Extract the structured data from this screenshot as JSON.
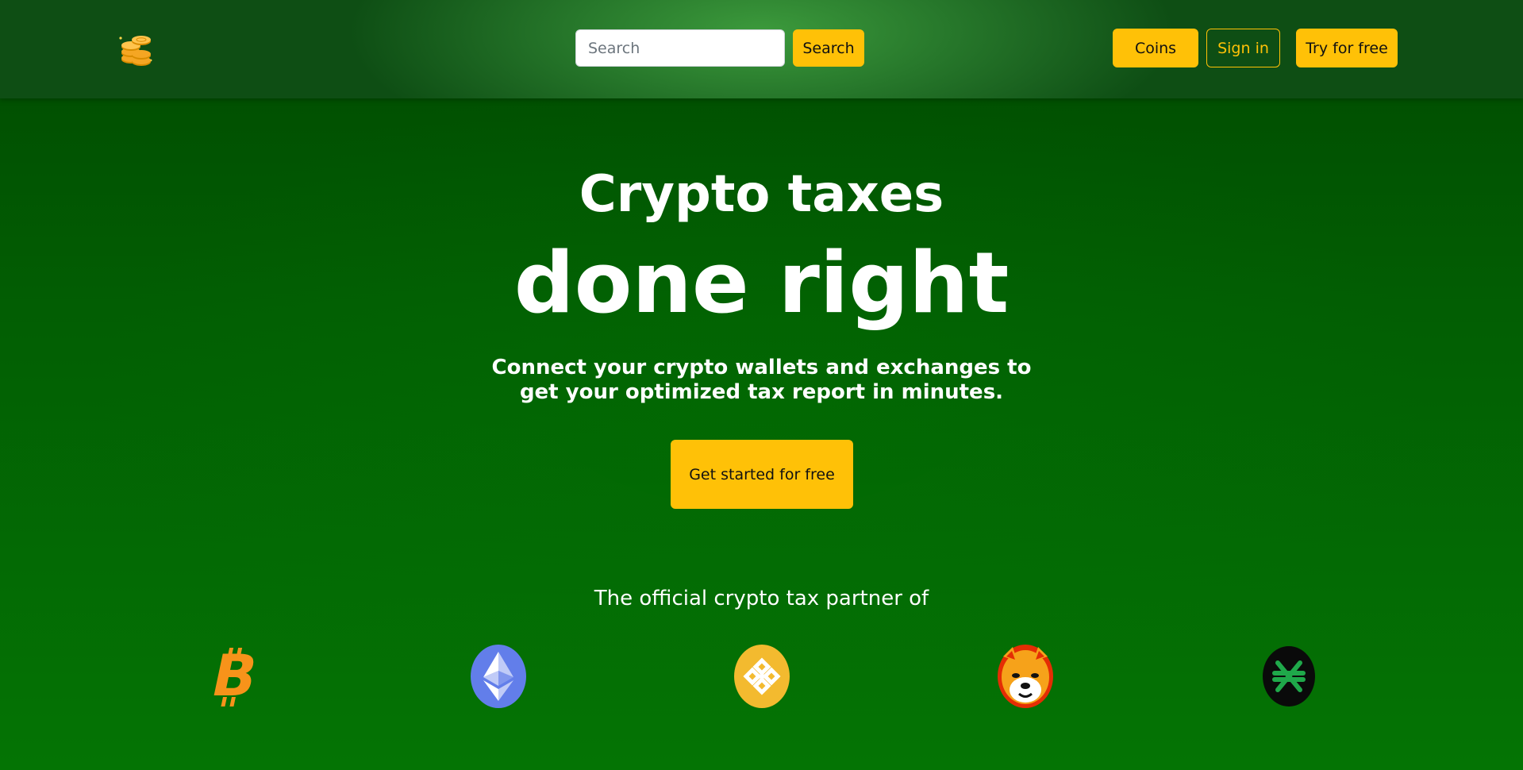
{
  "header": {
    "logo_icon": "coins-stack-icon",
    "search": {
      "placeholder": "Search",
      "value": ""
    },
    "search_button": "Search",
    "nav": {
      "coins": "Coins",
      "sign_in": "Sign in",
      "try_free": "Try for free"
    }
  },
  "hero": {
    "line1": "Crypto taxes",
    "line2": "done right",
    "subtitle": "Connect your crypto wallets and exchanges to get your optimized tax report in minutes.",
    "cta": "Get started for free"
  },
  "partners": {
    "heading": "The official crypto tax partner of",
    "logos": [
      "bitcoin-icon",
      "ethereum-icon",
      "binance-icon",
      "shiba-inu-icon",
      "stacks-icon"
    ]
  },
  "colors": {
    "accent": "#ffc107",
    "background_top": "#004a00",
    "background_bottom": "#047404",
    "header": "#2e8a32",
    "text": "#ffffff"
  }
}
